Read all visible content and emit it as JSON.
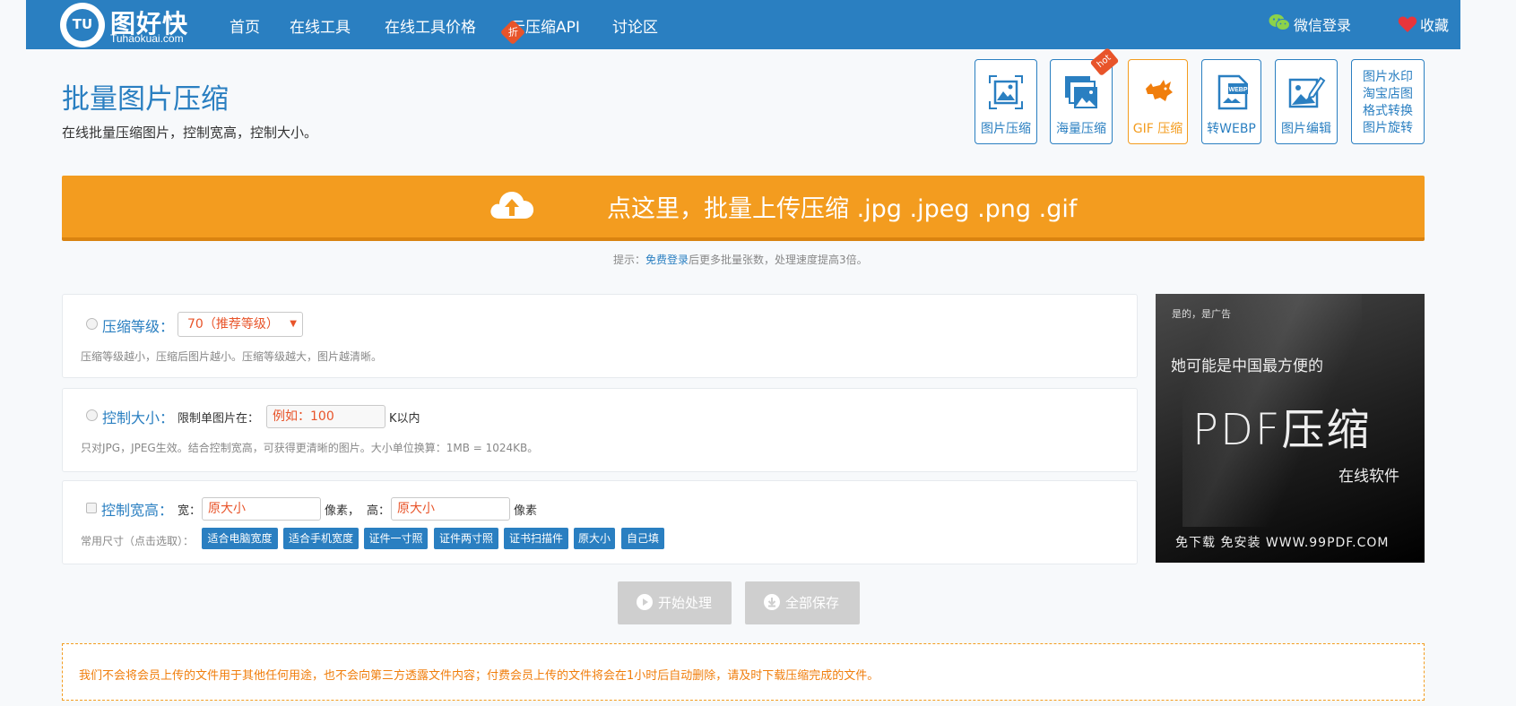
{
  "header": {
    "logo": {
      "badge": "TU",
      "name": "图好快",
      "sub": "Tuhaokuai.com"
    },
    "nav": [
      "首页",
      "在线工具",
      "在线工具价格",
      "云压缩API",
      "讨论区"
    ],
    "sale_tag": "折",
    "wechat_login": "微信登录",
    "favorite": "收藏"
  },
  "page": {
    "title": "批量图片压缩",
    "subtitle": "在线批量压缩图片，控制宽高，控制大小。"
  },
  "tools": [
    {
      "label": "图片压缩",
      "icon": "image-icon"
    },
    {
      "label": "海量压缩",
      "icon": "images-stack-icon"
    },
    {
      "label": "GIF 压缩",
      "icon": "gif-animal-icon"
    },
    {
      "label": "转WEBP",
      "icon": "webp-file-icon"
    },
    {
      "label": "图片编辑",
      "icon": "image-edit-icon"
    }
  ],
  "hot_tag": "hot",
  "more_tools": [
    "图片水印",
    "淘宝店图",
    "格式转换",
    "图片旋转"
  ],
  "upload": {
    "label": "点这里，批量上传压缩 .jpg .jpeg .png .gif",
    "icon": "cloud-upload-icon"
  },
  "hint": {
    "prefix": "提示：",
    "link": "免费登录",
    "suffix": "后更多批量张数，处理速度提高3倍。"
  },
  "compress_level": {
    "label": "压缩等级：",
    "selected": "70（推荐等级）",
    "note": "压缩等级越小，压缩后图片越小。压缩等级越大，图片越清晰。"
  },
  "size_limit": {
    "label": "控制大小：",
    "prefix": "限制单图片在：",
    "placeholder": "例如：100",
    "suffix": "K以内",
    "note": "只对JPG，JPEG生效。结合控制宽高，可获得更清晰的图片。大小单位换算：1MB = 1024KB。"
  },
  "dimensions": {
    "label": "控制宽高：",
    "width_label": "宽：",
    "width_placeholder": "原大小",
    "width_unit": "像素，",
    "height_label": "高：",
    "height_placeholder": "原大小",
    "height_unit": "像素",
    "presets_label": "常用尺寸（点击选取）：",
    "presets": [
      "适合电脑宽度",
      "适合手机宽度",
      "证件一寸照",
      "证件两寸照",
      "证书扫描件",
      "原大小",
      "自己填"
    ]
  },
  "actions": {
    "start": "开始处理",
    "save_all": "全部保存"
  },
  "ad": {
    "tag": "是的，是广告",
    "line1": "她可能是中国最方便的",
    "headline": "PDF压缩",
    "line3": "在线软件",
    "footer": "免下载 免安装 WWW.99PDF.COM"
  },
  "notice": "我们不会将会员上传的文件用于其他任何用途，也不会向第三方透露文件内容；付费会员上传的文件将会在1小时后自动删除，请及时下载压缩完成的文件。",
  "colors": {
    "brand": "#2a7fc1",
    "accent": "#f39c1f",
    "warning": "#e8542a"
  }
}
